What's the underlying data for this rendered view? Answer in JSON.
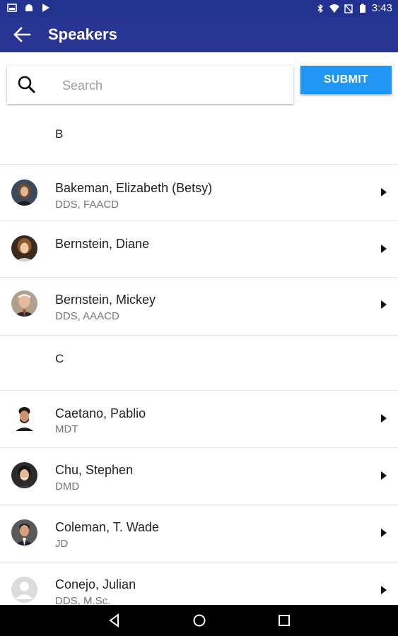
{
  "statusbar": {
    "time": "3:43"
  },
  "appbar": {
    "title": "Speakers"
  },
  "search": {
    "placeholder": "Search",
    "value": ""
  },
  "submit_label": "SUBMIT",
  "sections": [
    {
      "letter": "B",
      "speakers": [
        {
          "name": "Bakeman, Elizabeth (Betsy)",
          "credentials": "DDS, FAACD"
        },
        {
          "name": "Bernstein, Diane",
          "credentials": ""
        },
        {
          "name": "Bernstein, Mickey",
          "credentials": "DDS, AAACD"
        }
      ]
    },
    {
      "letter": "C",
      "speakers": [
        {
          "name": "Caetano, Pablio",
          "credentials": "MDT"
        },
        {
          "name": "Chu, Stephen",
          "credentials": "DMD"
        },
        {
          "name": "Coleman, T. Wade",
          "credentials": "JD"
        },
        {
          "name": "Conejo, Julian",
          "credentials": "DDS, M.Sc."
        }
      ]
    }
  ],
  "colors": {
    "statusbar": "#23318f",
    "appbar": "#283593",
    "submit": "#2196f3",
    "divider": "#e6e6e6"
  },
  "icons": [
    "back-arrow-icon",
    "search-icon",
    "chevron-right-icon",
    "nav-back-icon",
    "nav-home-icon",
    "nav-recents-icon"
  ]
}
